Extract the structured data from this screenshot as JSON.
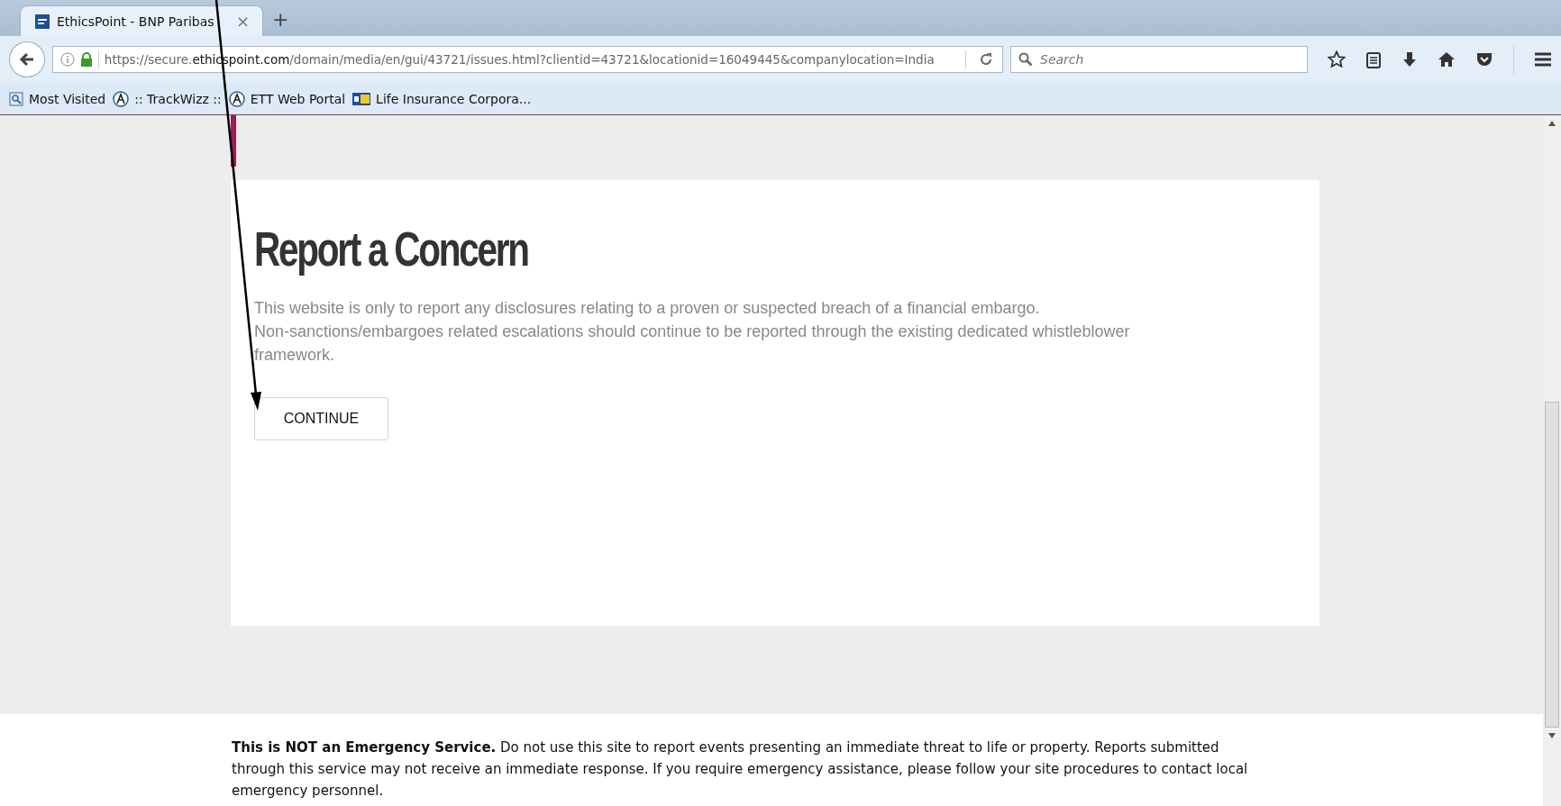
{
  "browser": {
    "tab": {
      "title": "EthicsPoint - BNP Paribas",
      "close": "×",
      "new_tab": "+"
    },
    "url": {
      "prefix": "https://secure.",
      "domain": "ethicspoint.com",
      "path": "/domain/media/en/gui/43721/issues.html?clientid=43721&locationid=16049445&companylocation=India"
    },
    "search": {
      "placeholder": "Search"
    },
    "bookmarks": [
      {
        "label": "Most Visited",
        "kind": "folder"
      },
      {
        "label": ":: TrackWizz ::",
        "kind": "site"
      },
      {
        "label": "ETT Web Portal",
        "kind": "site"
      },
      {
        "label": "Life Insurance Corpora...",
        "kind": "logo"
      }
    ]
  },
  "page": {
    "title": "Report a Concern",
    "description": [
      "This website is only to report any disclosures relating to a proven or suspected breach of a financial embargo.",
      "Non-sanctions/embargoes related escalations should continue to be reported through the existing dedicated whistleblower framework."
    ],
    "button": "CONTINUE"
  },
  "footer": {
    "notice": "**This is NOT an Emergency Service.** Do not use this site to report events presenting an immediate threat to life or property. Reports submitted through this service may not receive an immediate response. If you require emergency assistance, please follow your site procedures to contact local emergency personnel."
  }
}
